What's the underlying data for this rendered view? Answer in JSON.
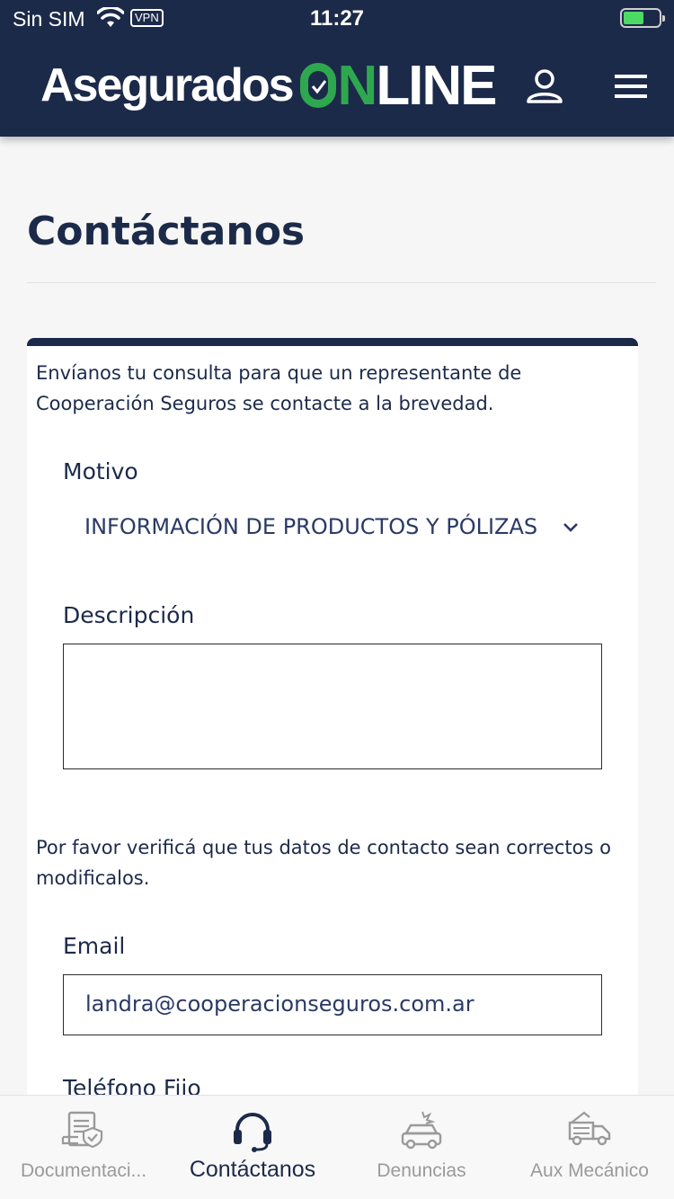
{
  "status_bar": {
    "carrier": "Sin SIM",
    "vpn": "VPN",
    "time": "11:27"
  },
  "header": {
    "logo_left": "Asegurados",
    "logo_on": "N",
    "logo_line": "LINE"
  },
  "page": {
    "title": "Contáctanos"
  },
  "form": {
    "intro": "Envíanos tu consulta para que un representante de Cooperación Seguros se contacte a la brevedad.",
    "motivo_label": "Motivo",
    "motivo_value": "INFORMACIÓN DE PRODUCTOS Y PÓLIZAS",
    "descripcion_label": "Descripción",
    "descripcion_value": "",
    "verify_text": "Por favor verificá que tus datos de contacto sean correctos o modificalos.",
    "email_label": "Email",
    "email_value": "landra@cooperacionseguros.com.ar",
    "telefono_label": "Teléfono Fijo"
  },
  "tabs": [
    {
      "label": "Documentaci...",
      "icon": "document-icon",
      "active": false
    },
    {
      "label": "Contáctanos",
      "icon": "headset-icon",
      "active": true
    },
    {
      "label": "Denuncias",
      "icon": "car-crash-icon",
      "active": false
    },
    {
      "label": "Aux Mecánico",
      "icon": "tow-truck-icon",
      "active": false
    }
  ],
  "colors": {
    "navy": "#1c2a4a",
    "green": "#2ea84e",
    "inactive": "#9a9a9a"
  }
}
